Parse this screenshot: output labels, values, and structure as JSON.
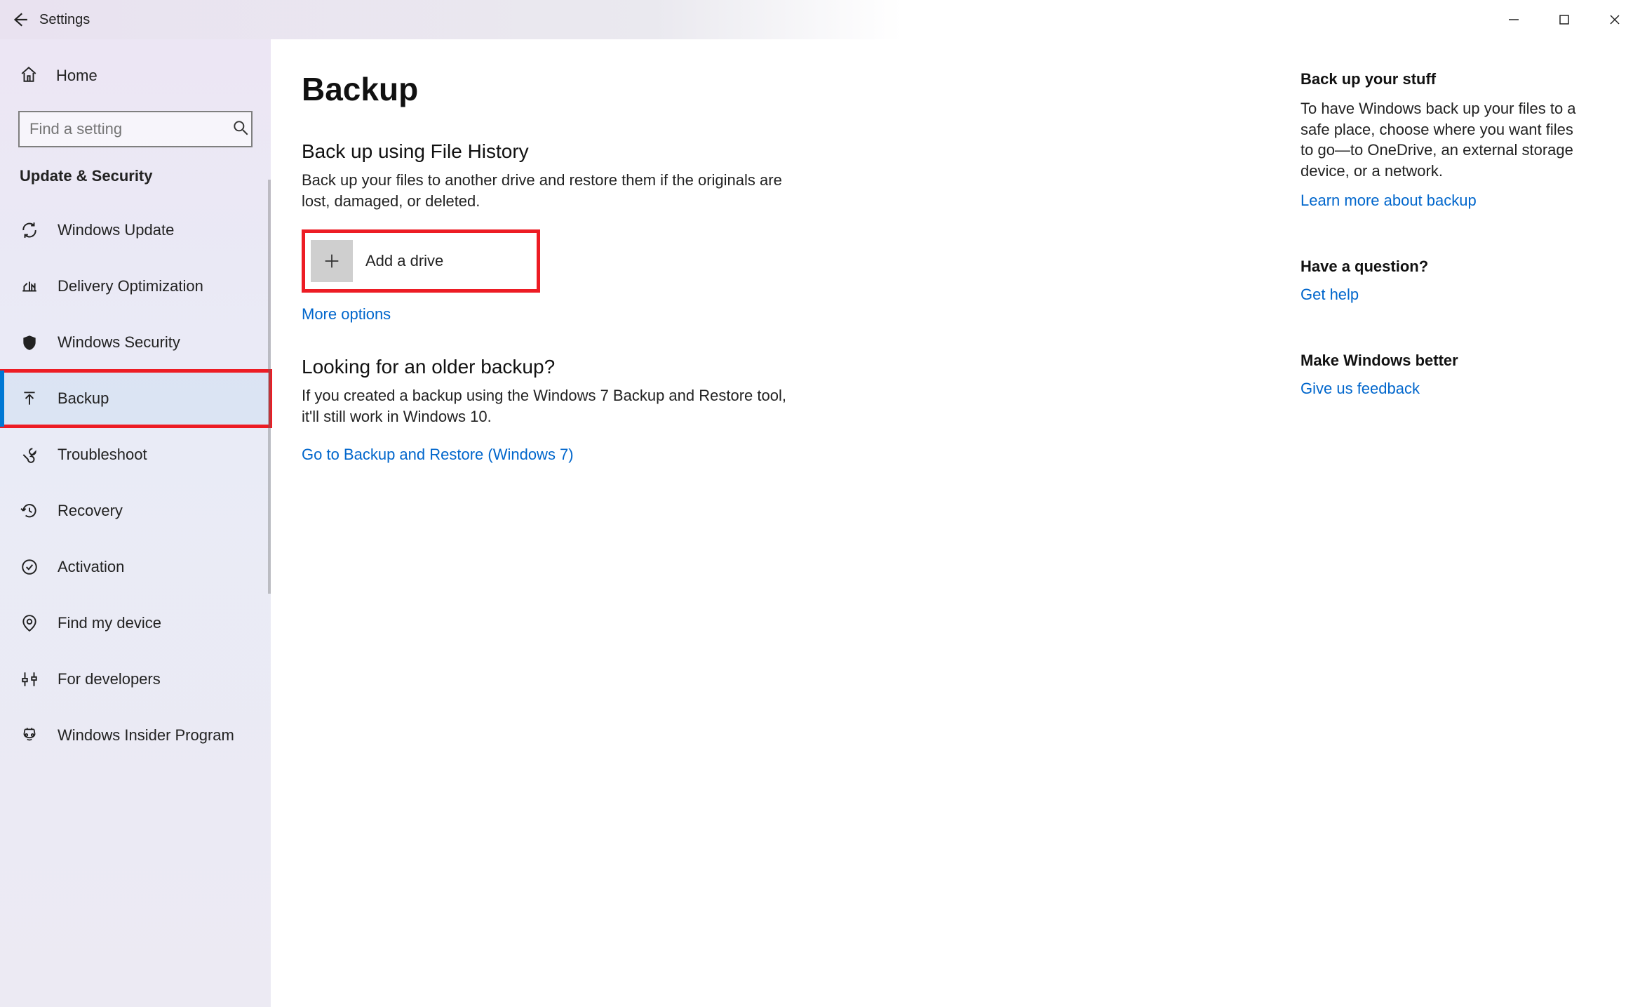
{
  "window": {
    "title": "Settings"
  },
  "sidebar": {
    "home": "Home",
    "search_placeholder": "Find a setting",
    "category": "Update & Security",
    "items": [
      {
        "label": "Windows Update"
      },
      {
        "label": "Delivery Optimization"
      },
      {
        "label": "Windows Security"
      },
      {
        "label": "Backup",
        "selected": true,
        "highlighted": true
      },
      {
        "label": "Troubleshoot"
      },
      {
        "label": "Recovery"
      },
      {
        "label": "Activation"
      },
      {
        "label": "Find my device"
      },
      {
        "label": "For developers"
      },
      {
        "label": "Windows Insider Program"
      }
    ]
  },
  "main": {
    "title": "Backup",
    "file_history": {
      "heading": "Back up using File History",
      "description": "Back up your files to another drive and restore them if the originals are lost, damaged, or deleted.",
      "add_drive_label": "Add a drive",
      "more_options": "More options"
    },
    "older_backup": {
      "heading": "Looking for an older backup?",
      "description": "If you created a backup using the Windows 7 Backup and Restore tool, it'll still work in Windows 10.",
      "link": "Go to Backup and Restore (Windows 7)"
    }
  },
  "side": {
    "stuff": {
      "heading": "Back up your stuff",
      "description": "To have Windows back up your files to a safe place, choose where you want files to go—to OneDrive, an external storage device, or a network.",
      "link": "Learn more about backup"
    },
    "question": {
      "heading": "Have a question?",
      "link": "Get help"
    },
    "feedback": {
      "heading": "Make Windows better",
      "link": "Give us feedback"
    }
  }
}
